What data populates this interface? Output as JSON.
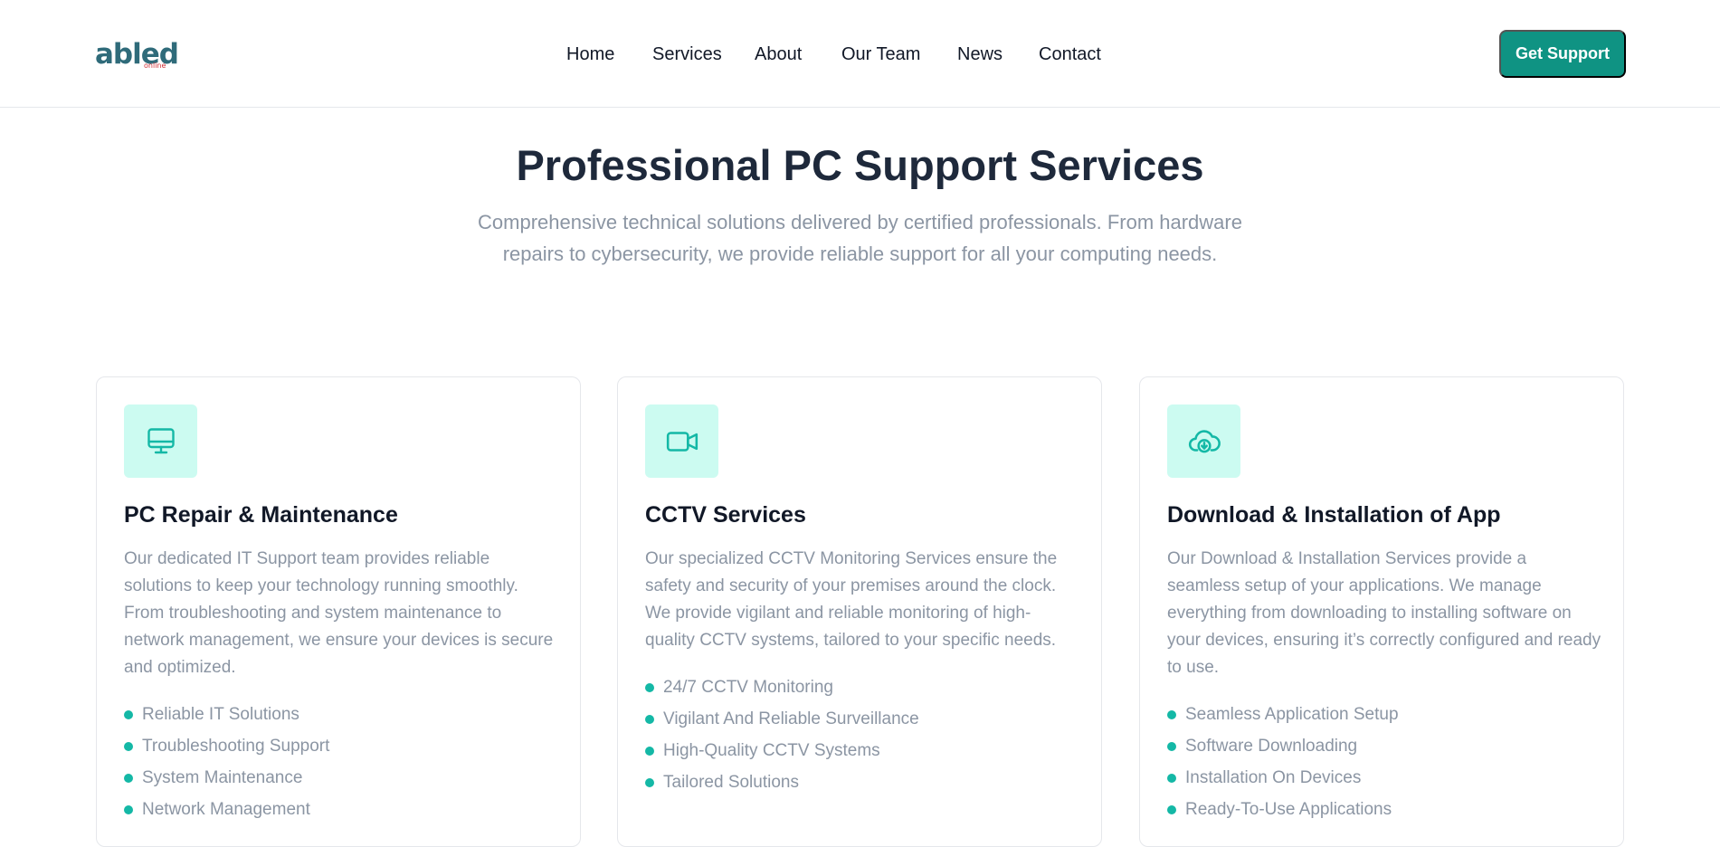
{
  "brand": {
    "logo_text": "abled",
    "logo_sub": "online"
  },
  "nav": {
    "items": [
      {
        "label": "Home"
      },
      {
        "label": "Services"
      },
      {
        "label": "About"
      },
      {
        "label": "Our Team"
      },
      {
        "label": "News"
      },
      {
        "label": "Contact"
      }
    ],
    "cta_label": "Get Support"
  },
  "hero": {
    "title": "Professional PC Support Services",
    "subtitle": "Comprehensive technical solutions delivered by certified professionals. From hardware repairs to cybersecurity, we provide reliable support for all your computing needs."
  },
  "services": [
    {
      "icon": "monitor-icon",
      "title": "PC Repair & Maintenance",
      "description": "Our dedicated IT Support team provides reliable solutions to keep your technology running smoothly. From troubleshooting and system maintenance to network management, we ensure your devices is secure and optimized.",
      "features": [
        "Reliable IT Solutions",
        "Troubleshooting Support",
        "System Maintenance",
        "Network Management"
      ]
    },
    {
      "icon": "video-camera-icon",
      "title": "CCTV Services",
      "description": "Our specialized CCTV Monitoring Services ensure the safety and security of your premises around the clock. We provide vigilant and reliable monitoring of high-quality CCTV systems, tailored to your specific needs.",
      "features": [
        "24/7 CCTV Monitoring",
        "Vigilant And Reliable Surveillance",
        "High-Quality CCTV Systems",
        "Tailored Solutions"
      ]
    },
    {
      "icon": "cloud-download-icon",
      "title": "Download & Installation of App",
      "description": "Our Download & Installation Services provide a seamless setup of your applications. We manage everything from downloading to installing software on your devices, ensuring it’s correctly configured and ready to use.",
      "features": [
        "Seamless Application Setup",
        "Software Downloading",
        "Installation On Devices",
        "Ready-To-Use Applications"
      ]
    }
  ],
  "colors": {
    "accent": "#0f9383",
    "icon_bg": "#ccfbf1",
    "bullet": "#14b8a6",
    "heading": "#1e293b",
    "muted_text": "#8b95a3"
  }
}
